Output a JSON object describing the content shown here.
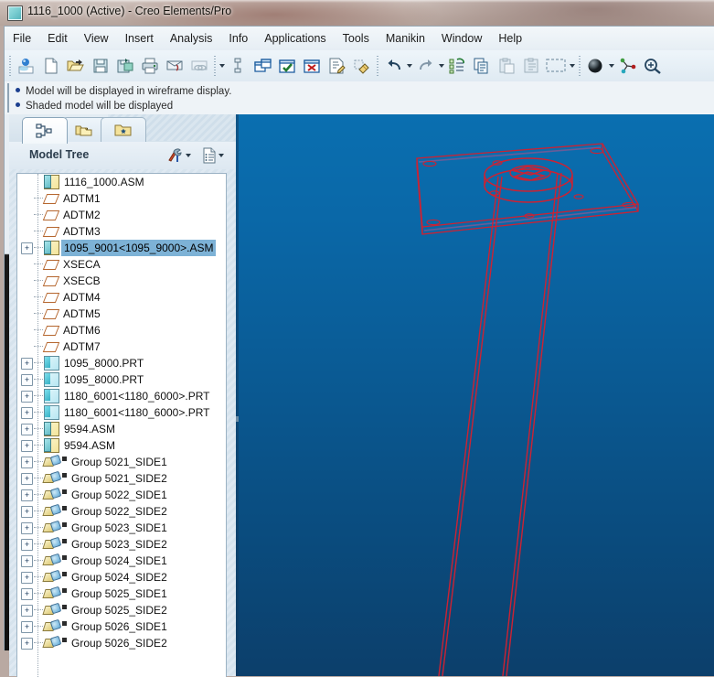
{
  "window": {
    "title": "1116_1000 (Active) - Creo Elements/Pro",
    "icon": "model-window-icon"
  },
  "menubar": {
    "items": [
      {
        "label": "File"
      },
      {
        "label": "Edit"
      },
      {
        "label": "View"
      },
      {
        "label": "Insert"
      },
      {
        "label": "Analysis"
      },
      {
        "label": "Info"
      },
      {
        "label": "Applications"
      },
      {
        "label": "Tools"
      },
      {
        "label": "Manikin"
      },
      {
        "label": "Window"
      },
      {
        "label": "Help"
      }
    ]
  },
  "toolbar": {
    "buttons": [
      {
        "name": "repaint-icon",
        "tip": "Repaint"
      },
      {
        "name": "new-file-icon",
        "tip": "New"
      },
      {
        "name": "open-file-icon",
        "tip": "Open"
      },
      {
        "name": "save-icon",
        "tip": "Save"
      },
      {
        "name": "save-a-copy-icon",
        "tip": "Save a Copy"
      },
      {
        "name": "print-icon",
        "tip": "Print"
      },
      {
        "name": "send-mail-icon",
        "tip": "Send"
      },
      {
        "name": "link-icon",
        "tip": "Link"
      },
      {
        "name": "datum-display-icon",
        "tip": "Datum Display Filters"
      },
      {
        "name": "new-window-icon",
        "tip": "New Window"
      },
      {
        "name": "regenerate-icon",
        "tip": "Regenerate"
      },
      {
        "name": "delete-window-icon",
        "tip": "Close Window"
      },
      {
        "name": "annotation-icon",
        "tip": "Annotation"
      },
      {
        "name": "erase-icon",
        "tip": "Erase"
      },
      {
        "name": "undo-icon",
        "tip": "Undo"
      },
      {
        "name": "redo-icon",
        "tip": "Redo"
      },
      {
        "name": "regen-model-icon",
        "tip": "Regenerate Model"
      },
      {
        "name": "copy-icon",
        "tip": "Copy"
      },
      {
        "name": "paste-icon",
        "tip": "Paste"
      },
      {
        "name": "paste-special-icon",
        "tip": "Paste Special"
      },
      {
        "name": "select-box-icon",
        "tip": "Selection Box"
      },
      {
        "name": "shading-icon",
        "tip": "Display Style"
      },
      {
        "name": "datum-axes-icon",
        "tip": "Datum Axes"
      },
      {
        "name": "zoom-in-icon",
        "tip": "Zoom In"
      }
    ]
  },
  "messages": [
    "Model will be displayed in wireframe display.",
    "Shaded model will be displayed"
  ],
  "navigator": {
    "tabs": [
      {
        "name": "model-tree-tab",
        "icon": "model-tree-icon",
        "active": true
      },
      {
        "name": "folder-browser-tab",
        "icon": "folders-icon",
        "active": false
      },
      {
        "name": "favorites-tab",
        "icon": "favorites-folder-icon",
        "active": false
      }
    ]
  },
  "model_tree": {
    "title": "Model Tree",
    "tools": [
      {
        "name": "settings-tools-icon"
      },
      {
        "name": "tree-columns-icon"
      }
    ],
    "rows": [
      {
        "label": "1116_1000.ASM",
        "icon": "assembly-icon",
        "indent": 0,
        "expander": "none",
        "selected": false
      },
      {
        "label": "ADTM1",
        "icon": "datum-plane-icon",
        "indent": 1,
        "expander": "none",
        "selected": false
      },
      {
        "label": "ADTM2",
        "icon": "datum-plane-icon",
        "indent": 1,
        "expander": "none",
        "selected": false
      },
      {
        "label": "ADTM3",
        "icon": "datum-plane-icon",
        "indent": 1,
        "expander": "none",
        "selected": false
      },
      {
        "label": "1095_9001<1095_9000>.ASM",
        "icon": "assembly-icon",
        "indent": 1,
        "expander": "plus",
        "selected": true
      },
      {
        "label": "XSECA",
        "icon": "datum-plane-icon",
        "indent": 1,
        "expander": "none",
        "selected": false
      },
      {
        "label": "XSECB",
        "icon": "datum-plane-icon",
        "indent": 1,
        "expander": "none",
        "selected": false
      },
      {
        "label": "ADTM4",
        "icon": "datum-plane-icon",
        "indent": 1,
        "expander": "none",
        "selected": false
      },
      {
        "label": "ADTM5",
        "icon": "datum-plane-icon",
        "indent": 1,
        "expander": "none",
        "selected": false
      },
      {
        "label": "ADTM6",
        "icon": "datum-plane-icon",
        "indent": 1,
        "expander": "none",
        "selected": false
      },
      {
        "label": "ADTM7",
        "icon": "datum-plane-icon",
        "indent": 1,
        "expander": "none",
        "selected": false
      },
      {
        "label": "1095_8000.PRT",
        "icon": "part-icon",
        "indent": 1,
        "expander": "plus",
        "selected": false
      },
      {
        "label": "1095_8000.PRT",
        "icon": "part-icon",
        "indent": 1,
        "expander": "plus",
        "selected": false
      },
      {
        "label": "1180_6001<1180_6000>.PRT",
        "icon": "part-icon",
        "indent": 1,
        "expander": "plus",
        "selected": false
      },
      {
        "label": "1180_6001<1180_6000>.PRT",
        "icon": "part-icon",
        "indent": 1,
        "expander": "plus",
        "selected": false
      },
      {
        "label": "9594.ASM",
        "icon": "assembly-icon",
        "indent": 1,
        "expander": "plus",
        "selected": false
      },
      {
        "label": "9594.ASM",
        "icon": "assembly-icon",
        "indent": 1,
        "expander": "plus",
        "selected": false
      },
      {
        "label": "Group 5021_SIDE1",
        "icon": "group-icon",
        "indent": 1,
        "expander": "plus",
        "selected": false
      },
      {
        "label": "Group 5021_SIDE2",
        "icon": "group-icon",
        "indent": 1,
        "expander": "plus",
        "selected": false
      },
      {
        "label": "Group 5022_SIDE1",
        "icon": "group-icon",
        "indent": 1,
        "expander": "plus",
        "selected": false
      },
      {
        "label": "Group 5022_SIDE2",
        "icon": "group-icon",
        "indent": 1,
        "expander": "plus",
        "selected": false
      },
      {
        "label": "Group 5023_SIDE1",
        "icon": "group-icon",
        "indent": 1,
        "expander": "plus",
        "selected": false
      },
      {
        "label": "Group 5023_SIDE2",
        "icon": "group-icon",
        "indent": 1,
        "expander": "plus",
        "selected": false
      },
      {
        "label": "Group 5024_SIDE1",
        "icon": "group-icon",
        "indent": 1,
        "expander": "plus",
        "selected": false
      },
      {
        "label": "Group 5024_SIDE2",
        "icon": "group-icon",
        "indent": 1,
        "expander": "plus",
        "selected": false
      },
      {
        "label": "Group 5025_SIDE1",
        "icon": "group-icon",
        "indent": 1,
        "expander": "plus",
        "selected": false
      },
      {
        "label": "Group 5025_SIDE2",
        "icon": "group-icon",
        "indent": 1,
        "expander": "plus",
        "selected": false
      },
      {
        "label": "Group 5026_SIDE1",
        "icon": "group-icon",
        "indent": 1,
        "expander": "plus",
        "selected": false
      },
      {
        "label": "Group 5026_SIDE2",
        "icon": "group-icon",
        "indent": 1,
        "expander": "plus",
        "selected": false
      }
    ]
  },
  "viewport": {
    "name": "graphics-window",
    "display_mode": "wireframe",
    "background_top": "#0a6fb0",
    "background_bottom": "#0c3f6b",
    "geometry_color": "#cc2233",
    "highlight_color": "#6b4a8f",
    "model": "baseplate with cylindrical column"
  },
  "colors": {
    "selection_highlight": "#7db2d6",
    "menu_text": "#1c1c1c",
    "panel_background": "#eef3f7"
  }
}
